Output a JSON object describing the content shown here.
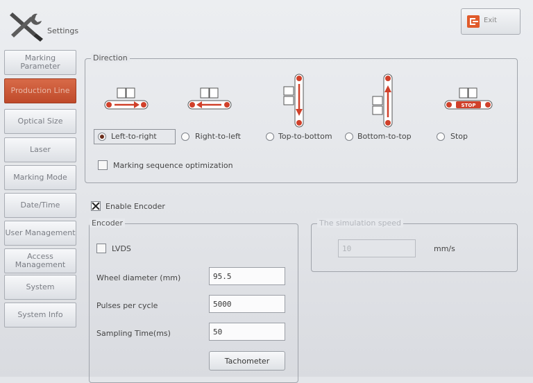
{
  "header": {
    "title": "Settings",
    "exit_label": "Exit"
  },
  "sidebar": {
    "items": [
      {
        "label": "Marking Parameter",
        "active": false
      },
      {
        "label": "Production Line",
        "active": true
      },
      {
        "label": "Optical Size",
        "active": false
      },
      {
        "label": "Laser",
        "active": false
      },
      {
        "label": "Marking Mode",
        "active": false
      },
      {
        "label": "Date/Time",
        "active": false
      },
      {
        "label": "User Management",
        "active": false
      },
      {
        "label": "Access Management",
        "active": false
      },
      {
        "label": "System",
        "active": false
      },
      {
        "label": "System Info",
        "active": false
      }
    ]
  },
  "direction": {
    "legend": "Direction",
    "options": [
      {
        "label": "Left-to-right",
        "selected": true
      },
      {
        "label": "Right-to-left",
        "selected": false
      },
      {
        "label": "Top-to-bottom",
        "selected": false
      },
      {
        "label": "Bottom-to-top",
        "selected": false
      },
      {
        "label": "Stop",
        "selected": false
      }
    ],
    "stop_sign": "STOP",
    "sequence_optimization_label": "Marking sequence optimization",
    "sequence_optimization_checked": false
  },
  "encoder": {
    "enable_label": "Enable Encoder",
    "enabled": true,
    "legend": "Encoder",
    "lvds_label": "LVDS",
    "lvds_checked": false,
    "wheel_diameter_label": "Wheel diameter (mm)",
    "wheel_diameter_value": "95.5",
    "pulses_label": "Pulses per cycle",
    "pulses_value": "5000",
    "sampling_label": "Sampling Time(ms)",
    "sampling_value": "50",
    "tachometer_label": "Tachometer"
  },
  "simulation": {
    "legend": "The simulation speed",
    "value": "10",
    "unit": "mm/s"
  },
  "colors": {
    "accent": "#d0552f",
    "arrow": "#d0402a",
    "active_nav": "#c8542f"
  }
}
